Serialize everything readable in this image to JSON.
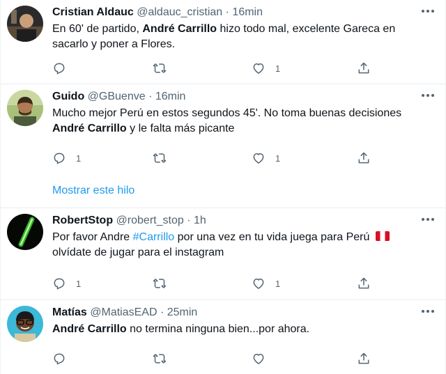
{
  "tweets": [
    {
      "name": "Cristian Aldauc",
      "handle": "@aldauc_cristian",
      "dot": "·",
      "time": "16min",
      "text_parts": [
        "En 60' de partido, ",
        "André Carrillo",
        " hizo todo mal, excelente Gareca en sacarlo y poner a Flores."
      ],
      "reply_count": "",
      "retweet_count": "",
      "like_count": "1"
    },
    {
      "name": "Guido",
      "handle": "@GBuenve",
      "dot": "·",
      "time": "16min",
      "text_parts": [
        "Mucho mejor Perú en estos segundos 45'. No toma buenas decisiones ",
        "André Carrillo",
        " y le falta más picante"
      ],
      "reply_count": "1",
      "retweet_count": "",
      "like_count": "1",
      "show_thread": "Mostrar este hilo"
    },
    {
      "name": "RobertStop",
      "handle": "@robert_stop",
      "dot": "·",
      "time": "1h",
      "text_parts": [
        "Por favor Andre ",
        "#Carrillo",
        " por una vez en tu vida juega para Perú ",
        " olvídate de jugar para el instagram"
      ],
      "reply_count": "1",
      "retweet_count": "",
      "like_count": "1"
    },
    {
      "name": "Matías",
      "handle": "@MatiasEAD",
      "dot": "·",
      "time": "25min",
      "text_parts": [
        "André Carrillo",
        " no termina ninguna bien...por ahora."
      ],
      "reply_count": "",
      "retweet_count": "",
      "like_count": ""
    }
  ],
  "icons": {
    "reply": "reply-icon",
    "retweet": "retweet-icon",
    "like": "heart-icon",
    "share": "share-icon",
    "more": "more-icon",
    "flag": "peru-flag-icon"
  },
  "colors": {
    "link": "#1d9bf0",
    "secondary_text": "#536471",
    "divider": "#e6ecf0"
  }
}
